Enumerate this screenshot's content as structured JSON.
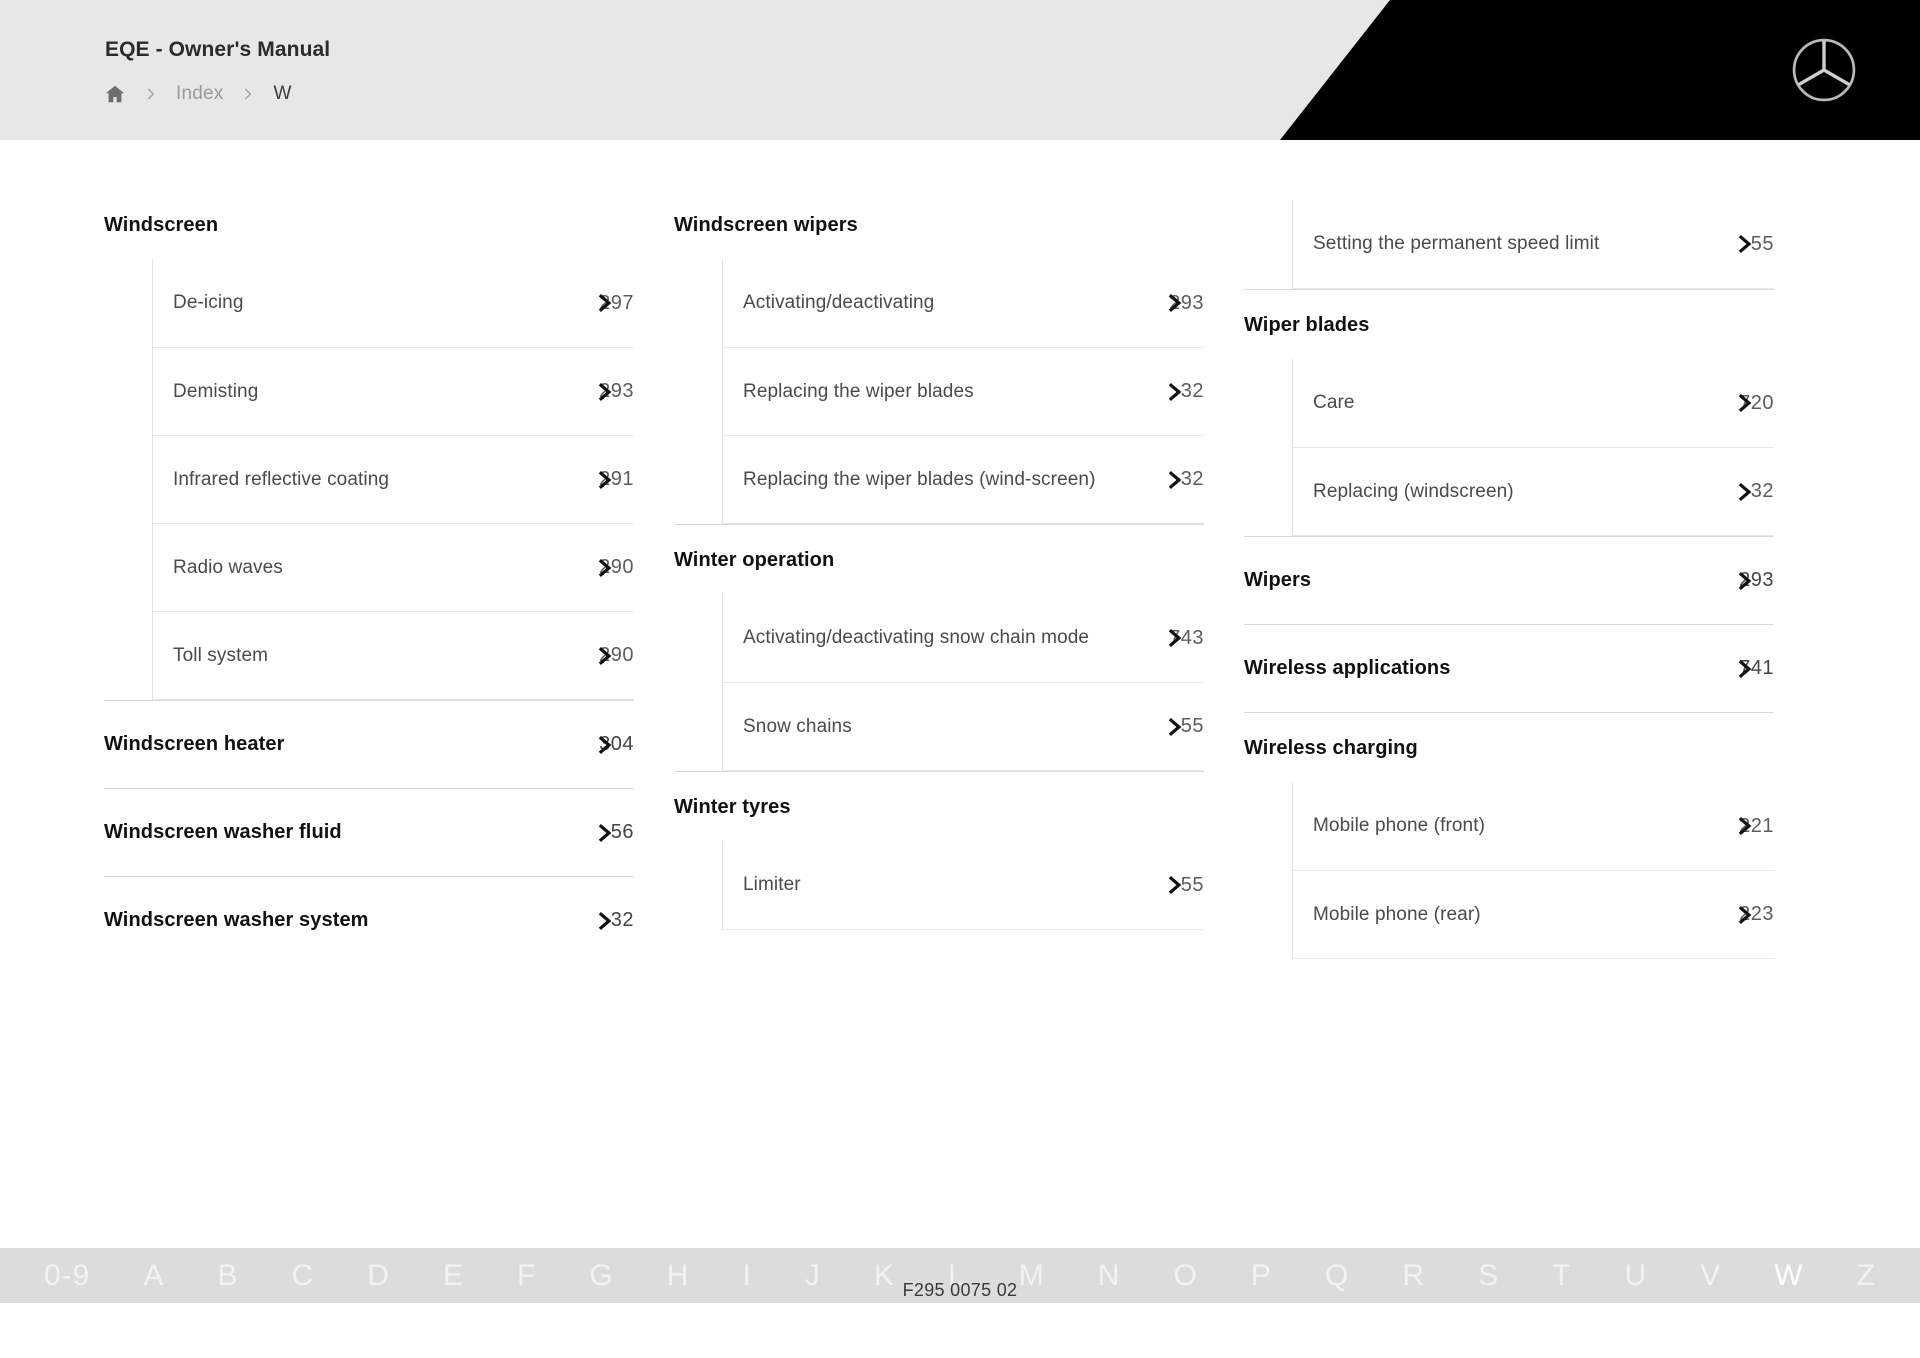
{
  "header": {
    "title": "EQE - Owner's Manual",
    "home_icon": "home-icon",
    "sep_icon": "chevron-right-icon",
    "breadcrumb": [
      {
        "label": "Index",
        "current": false
      },
      {
        "label": "W",
        "current": true
      }
    ],
    "logo": "mercedes-star-logo",
    "colors": {
      "bar": "#e7e7e7",
      "panel": "#000000",
      "star": "#c8c8c8"
    }
  },
  "columns": [
    {
      "blocks": [
        {
          "kind": "group",
          "title": "Windscreen",
          "first": true,
          "children": [
            {
              "label": "De-icing",
              "page": "297"
            },
            {
              "label": "Demisting",
              "page": "293"
            },
            {
              "label": "Infrared reflective coating",
              "page": "291"
            },
            {
              "label": "Radio waves",
              "page": "290"
            },
            {
              "label": "Toll system",
              "page": "290"
            }
          ]
        },
        {
          "kind": "row",
          "title": "Windscreen heater",
          "page": "304"
        },
        {
          "kind": "row",
          "title": "Windscreen washer fluid",
          "page": "56"
        },
        {
          "kind": "row",
          "title": "Windscreen washer system",
          "page": "32"
        }
      ]
    },
    {
      "blocks": [
        {
          "kind": "group",
          "title": "Windscreen wipers",
          "first": true,
          "children": [
            {
              "label": "Activating/deactivating",
              "page": "293"
            },
            {
              "label": "Replacing the wiper blades",
              "page": "32"
            },
            {
              "label": "Replacing the wiper blades (wind-screen)",
              "page": "32"
            }
          ]
        },
        {
          "kind": "group",
          "title": "Winter operation",
          "children": [
            {
              "label": "Activating/deactivating snow chain mode",
              "page": "743"
            },
            {
              "label": "Snow chains",
              "page": "55"
            }
          ]
        },
        {
          "kind": "group",
          "title": "Winter tyres",
          "children": [
            {
              "label": "Limiter",
              "page": "55"
            }
          ]
        }
      ]
    },
    {
      "blocks": [
        {
          "kind": "orphan",
          "children": [
            {
              "label": "Setting the permanent speed limit",
              "page": "55"
            }
          ]
        },
        {
          "kind": "group",
          "title": "Wiper blades",
          "children": [
            {
              "label": "Care",
              "page": "720"
            },
            {
              "label": "Replacing (windscreen)",
              "page": "32"
            }
          ]
        },
        {
          "kind": "row",
          "title": "Wipers",
          "page": "293"
        },
        {
          "kind": "row",
          "title": "Wireless applications",
          "page": "741"
        },
        {
          "kind": "group",
          "title": "Wireless charging",
          "children": [
            {
              "label": "Mobile phone (front)",
              "page": "221"
            },
            {
              "label": "Mobile phone (rear)",
              "page": "223"
            }
          ]
        }
      ]
    }
  ],
  "alphabet": {
    "letters": [
      "0-9",
      "A",
      "B",
      "C",
      "D",
      "E",
      "F",
      "G",
      "H",
      "I",
      "J",
      "K",
      "L",
      "M",
      "N",
      "O",
      "P",
      "Q",
      "R",
      "S",
      "T",
      "U",
      "V",
      "W",
      "Z"
    ],
    "active": "W"
  },
  "footer": {
    "document_code": "F295 0075 02"
  }
}
